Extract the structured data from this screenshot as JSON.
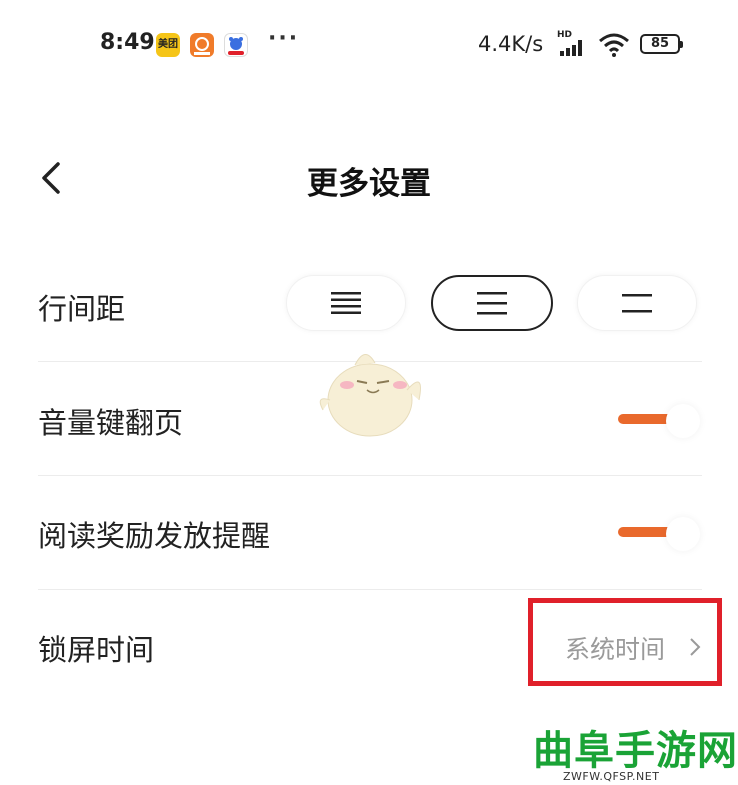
{
  "status_bar": {
    "time": "8:49",
    "app_icons": [
      {
        "name": "meituan-icon",
        "text": "美团",
        "color": "#f5c518"
      },
      {
        "name": "uc-browser-icon",
        "color": "#f07b2a"
      },
      {
        "name": "baidu-app-icon",
        "color": "#3a6fe0"
      }
    ],
    "more": "···",
    "network_speed": "4.4K/s",
    "hd": "HD",
    "battery": "85"
  },
  "header": {
    "title": "更多设置"
  },
  "settings": {
    "line_spacing": {
      "label": "行间距",
      "options": [
        "dense",
        "normal",
        "loose"
      ],
      "selected": "normal"
    },
    "volume_key_page": {
      "label": "音量键翻页",
      "on": true
    },
    "reading_reward_reminder": {
      "label": "阅读奖励发放提醒",
      "on": true
    },
    "lock_screen_time": {
      "label": "锁屏时间",
      "value": "系统时间"
    }
  },
  "colors": {
    "accent": "#e9692c",
    "highlight_box": "#e0202a",
    "watermark": "#1aa336"
  },
  "watermark": {
    "text": "曲阜手游网",
    "url": "ZWFW.QFSP.NET"
  }
}
